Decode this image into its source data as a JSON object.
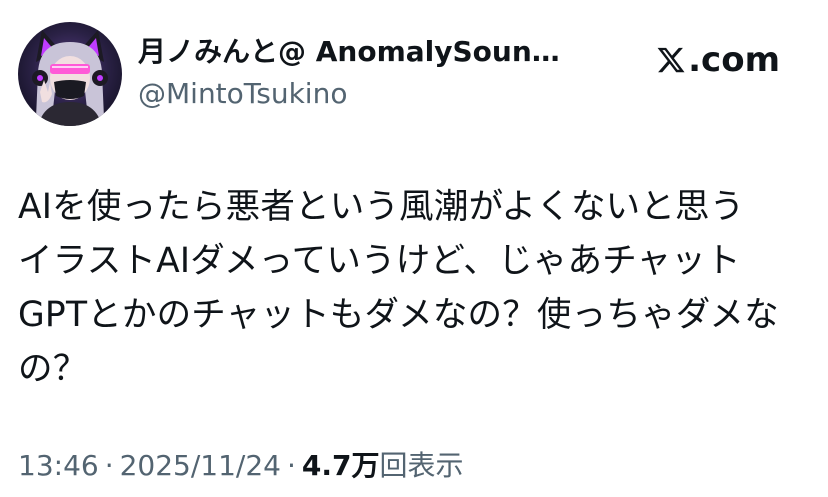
{
  "author": {
    "display_name": "月ノみんと@ AnomalySoun…",
    "handle": "@MintoTsukino"
  },
  "brand": {
    "logo_icon": "x-logo-icon",
    "text": ".com"
  },
  "tweet": {
    "lines": [
      "AIを使ったら悪者という風潮がよくないと思う",
      "イラストAIダメっていうけど、じゃあチャット",
      "GPTとかのチャットもダメなの？使っちゃダメな",
      "の？"
    ]
  },
  "meta": {
    "time": "13:46",
    "separator": "·",
    "date": "2025/11/24",
    "views_count": "4.7万",
    "views_label": "回表示"
  },
  "colors": {
    "text": "#0f1419",
    "secondary": "#536471",
    "avatar_accent": "#c13cff"
  }
}
